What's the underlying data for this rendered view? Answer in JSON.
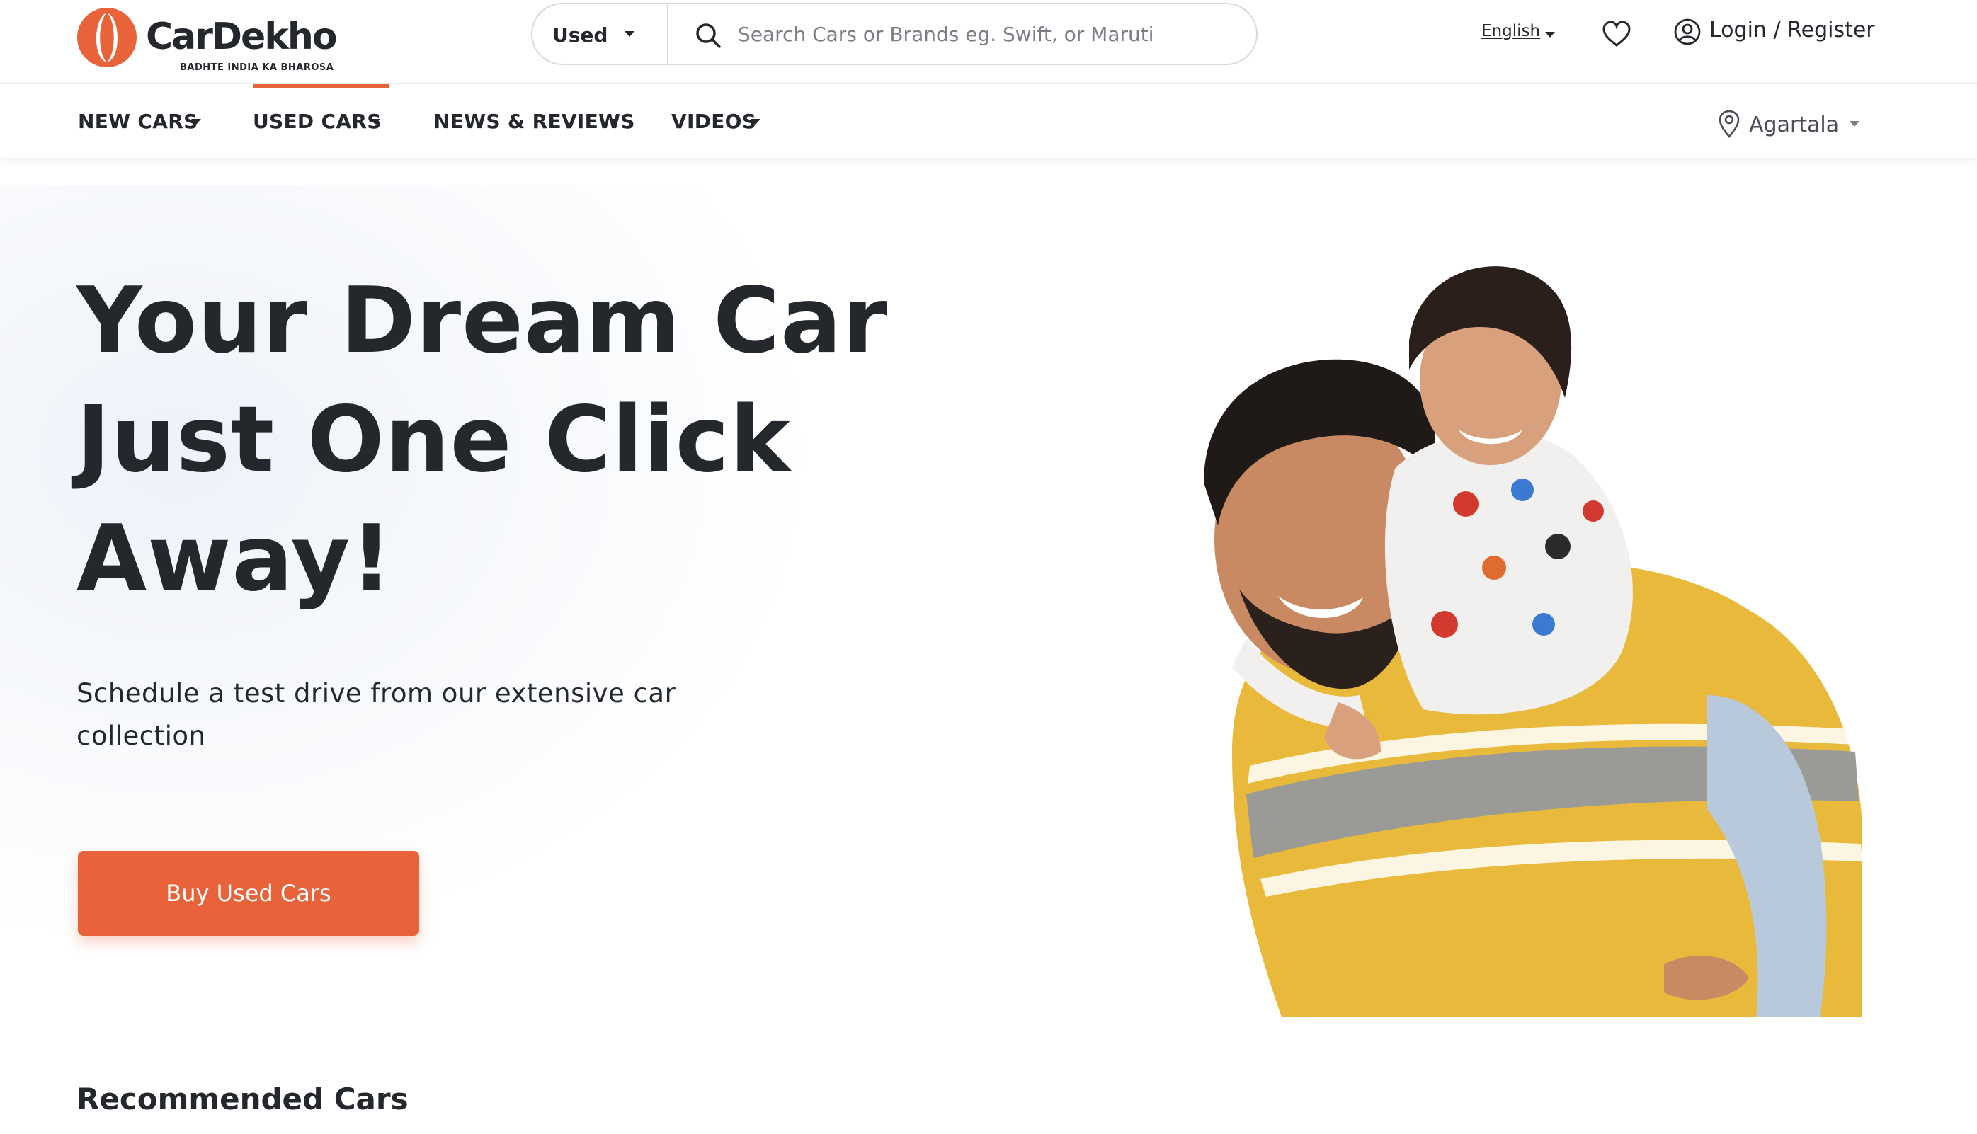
{
  "brand": {
    "name": "CarDekho",
    "tagline": "BADHTE INDIA KA BHAROSA",
    "accent_color": "#e8633a"
  },
  "search": {
    "type_selected": "Used",
    "placeholder": "Search Cars or Brands eg. Swift, or Maruti",
    "value": ""
  },
  "header": {
    "language": "English",
    "wishlist_icon": "heart-icon",
    "account_icon": "user-circle-icon",
    "login_label": "Login / Register"
  },
  "nav": {
    "items": [
      {
        "label": "NEW CARS"
      },
      {
        "label": "USED CARS",
        "active": true
      },
      {
        "label": "NEWS & REVIEWS"
      },
      {
        "label": "VIDEOS"
      }
    ],
    "location_icon": "location-pin-icon",
    "location": "Agartala"
  },
  "hero": {
    "title_lines": [
      "Your Dream Car",
      "Just One Click",
      "Away!"
    ],
    "subtitle": "Schedule a test drive from our extensive car collection",
    "cta_label": "Buy Used Cars"
  },
  "sections": {
    "recommended_title": "Recommended Cars"
  }
}
